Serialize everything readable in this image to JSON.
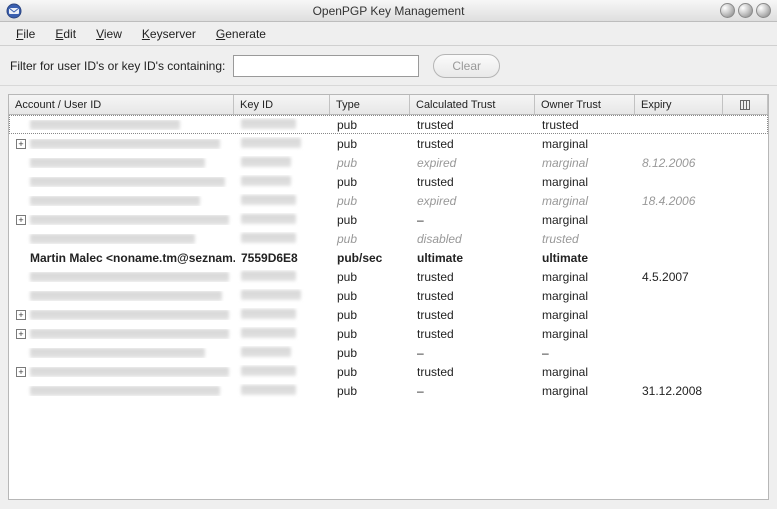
{
  "window": {
    "title": "OpenPGP Key Management"
  },
  "menu": {
    "file": "File",
    "edit": "Edit",
    "view": "View",
    "keyserver": "Keyserver",
    "generate": "Generate"
  },
  "filter": {
    "label": "Filter for user ID's or key ID's containing:",
    "value": "",
    "clear": "Clear"
  },
  "columns": {
    "user": "Account / User ID",
    "keyid": "Key ID",
    "type": "Type",
    "calc": "Calculated Trust",
    "owner": "Owner Trust",
    "expiry": "Expiry"
  },
  "rows": [
    {
      "expandable": false,
      "blurred": true,
      "style": "normal",
      "userW": 150,
      "keyW": 55,
      "type": "pub",
      "calc": "trusted",
      "owner": "trusted",
      "expiry": "",
      "focus": true
    },
    {
      "expandable": true,
      "blurred": true,
      "style": "normal",
      "userW": 190,
      "keyW": 60,
      "type": "pub",
      "calc": "trusted",
      "owner": "marginal",
      "expiry": ""
    },
    {
      "expandable": false,
      "blurred": true,
      "style": "inactive",
      "userW": 175,
      "keyW": 50,
      "type": "pub",
      "calc": "expired",
      "owner": "marginal",
      "expiry": "8.12.2006"
    },
    {
      "expandable": false,
      "blurred": true,
      "style": "normal",
      "userW": 195,
      "keyW": 50,
      "type": "pub",
      "calc": "trusted",
      "owner": "marginal",
      "expiry": ""
    },
    {
      "expandable": false,
      "blurred": true,
      "style": "inactive",
      "userW": 170,
      "keyW": 55,
      "type": "pub",
      "calc": "expired",
      "owner": "marginal",
      "expiry": "18.4.2006"
    },
    {
      "expandable": true,
      "blurred": true,
      "style": "normal",
      "userW": 200,
      "keyW": 55,
      "type": "pub",
      "calc": "–",
      "owner": "marginal",
      "expiry": ""
    },
    {
      "expandable": false,
      "blurred": true,
      "style": "inactive",
      "userW": 165,
      "keyW": 55,
      "type": "pub",
      "calc": "disabled",
      "owner": "trusted",
      "expiry": ""
    },
    {
      "expandable": false,
      "blurred": false,
      "style": "bold",
      "user": "Martin Malec <noname.tm@seznam....",
      "keyid": "7559D6E8",
      "type": "pub/sec",
      "calc": "ultimate",
      "owner": "ultimate",
      "expiry": ""
    },
    {
      "expandable": false,
      "blurred": true,
      "style": "normal",
      "userW": 200,
      "keyW": 55,
      "type": "pub",
      "calc": "trusted",
      "owner": "marginal",
      "expiry": "4.5.2007"
    },
    {
      "expandable": false,
      "blurred": true,
      "style": "normal",
      "userW": 192,
      "keyW": 60,
      "type": "pub",
      "calc": "trusted",
      "owner": "marginal",
      "expiry": ""
    },
    {
      "expandable": true,
      "blurred": true,
      "style": "normal",
      "userW": 200,
      "keyW": 55,
      "type": "pub",
      "calc": "trusted",
      "owner": "marginal",
      "expiry": ""
    },
    {
      "expandable": true,
      "blurred": true,
      "style": "normal",
      "userW": 200,
      "keyW": 55,
      "type": "pub",
      "calc": "trusted",
      "owner": "marginal",
      "expiry": ""
    },
    {
      "expandable": false,
      "blurred": true,
      "style": "normal",
      "userW": 175,
      "keyW": 50,
      "type": "pub",
      "calc": "–",
      "owner": "–",
      "expiry": ""
    },
    {
      "expandable": true,
      "blurred": true,
      "style": "normal",
      "userW": 200,
      "keyW": 55,
      "type": "pub",
      "calc": "trusted",
      "owner": "marginal",
      "expiry": ""
    },
    {
      "expandable": false,
      "blurred": true,
      "style": "normal",
      "userW": 190,
      "keyW": 55,
      "type": "pub",
      "calc": "–",
      "owner": "marginal",
      "expiry": "31.12.2008"
    }
  ]
}
